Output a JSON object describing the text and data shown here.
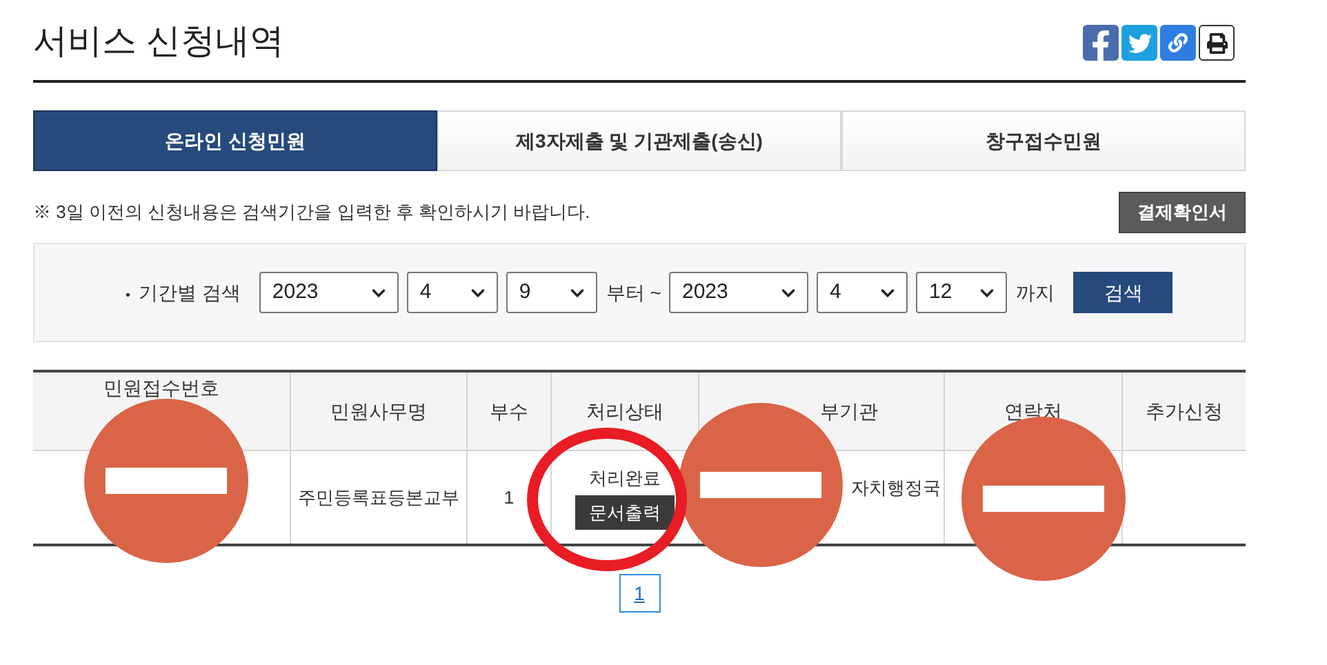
{
  "page_title": "서비스 신청내역",
  "tabs": [
    {
      "label": "온라인 신청민원",
      "selected": true
    },
    {
      "label": "제3자제출 및 기관제출(송신)",
      "selected": false
    },
    {
      "label": "창구접수민원",
      "selected": false
    }
  ],
  "notice": "※ 3일 이전의 신청내용은 검색기간을 입력한 후 확인하시기 바랍니다.",
  "receipt_button": "결제확인서",
  "search": {
    "bullet": "•",
    "label": "기간별 검색",
    "from": [
      "2023",
      "4",
      "9"
    ],
    "from_suffix": "부터 ~",
    "to": [
      "2023",
      "4",
      "12"
    ],
    "to_suffix": "까지",
    "button": "검색"
  },
  "table": {
    "columns": [
      "민원접수번호",
      "민원사무명",
      "부수",
      "처리상태",
      "부기관",
      "연락처",
      "추가신청"
    ],
    "rows": [
      {
        "service": "주민등록표등본교부",
        "copies": "1",
        "status": "처리완료",
        "print_button": "문서출력",
        "agency": "자치행정국"
      }
    ]
  },
  "pagination": [
    {
      "label": "1",
      "selected": true
    }
  ]
}
